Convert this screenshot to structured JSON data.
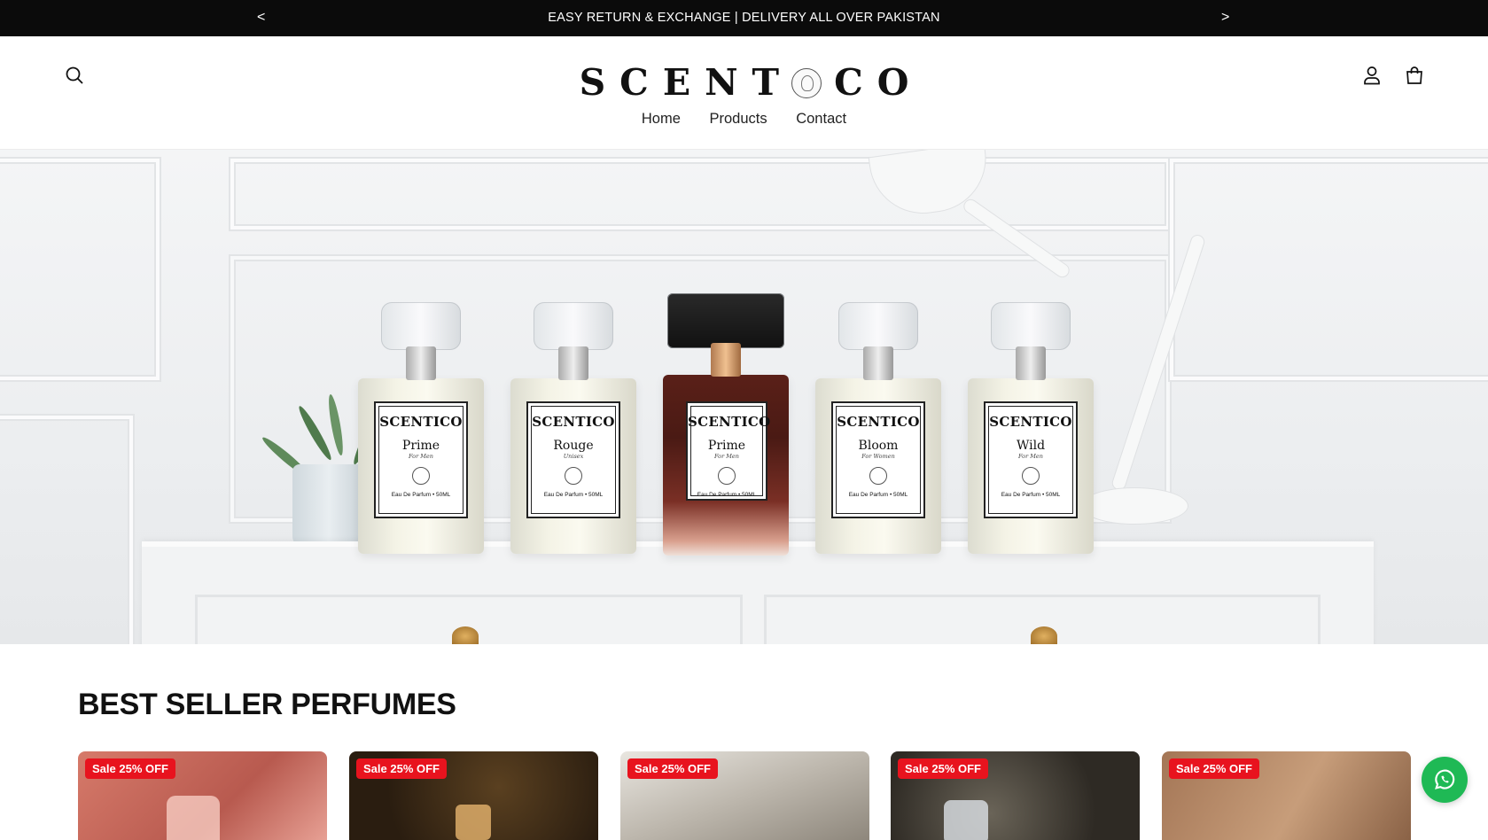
{
  "announcement": {
    "message": "EASY RETURN & EXCHANGE | DELIVERY ALL OVER PAKISTAN",
    "prev_label": "<",
    "next_label": ">"
  },
  "header": {
    "logo_left": "SCENT",
    "logo_right": "CO",
    "nav": [
      "Home",
      "Products",
      "Contact"
    ],
    "icons": [
      "search-icon",
      "account-icon",
      "cart-icon"
    ]
  },
  "hero": {
    "bottles": [
      {
        "brand": "SCENTICO",
        "name": "Prime",
        "for": "For Men",
        "volume": "Eau De Parfum • 50ML"
      },
      {
        "brand": "SCENTICO",
        "name": "Rouge",
        "for": "Unisex",
        "volume": "Eau De Parfum • 50ML"
      },
      {
        "brand": "SCENTICO",
        "name": "Prime",
        "for": "For Men",
        "volume": "Eau De Parfum • 50ML"
      },
      {
        "brand": "SCENTICO",
        "name": "Bloom",
        "for": "For Women",
        "volume": "Eau De Parfum • 50ML"
      },
      {
        "brand": "SCENTICO",
        "name": "Wild",
        "for": "For Men",
        "volume": "Eau De Parfum • 50ML"
      }
    ]
  },
  "best_seller": {
    "title": "BEST SELLER PERFUMES",
    "cards": [
      {
        "badge": "Sale 25% OFF",
        "bg": "#c86a5c"
      },
      {
        "badge": "Sale 25% OFF",
        "bg": "#3a2a18"
      },
      {
        "badge": "Sale 25% OFF",
        "bg": "#cfcac2"
      },
      {
        "badge": "Sale 25% OFF",
        "bg": "#3a3630"
      },
      {
        "badge": "Sale 25% OFF",
        "bg": "#b08462"
      }
    ]
  },
  "colors": {
    "announcement_bg": "#0b0b0b",
    "sale_badge": "#e8131e",
    "whatsapp": "#1fb955"
  },
  "floating": {
    "icon": "whatsapp-icon"
  }
}
